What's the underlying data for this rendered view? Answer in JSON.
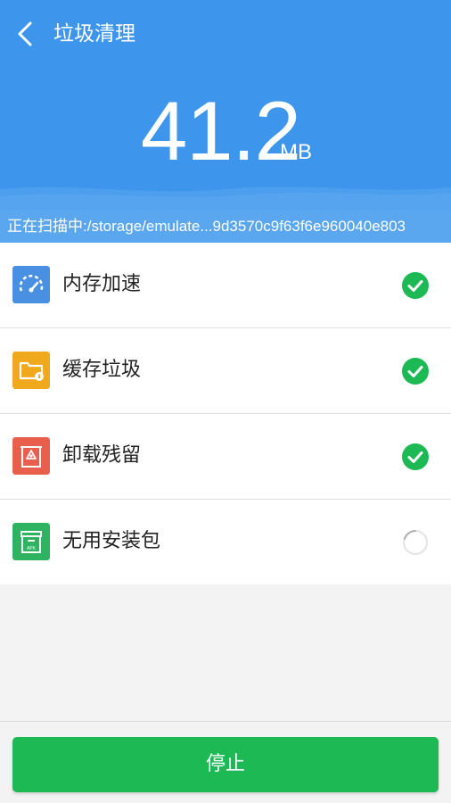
{
  "header": {
    "title": "垃圾清理",
    "back_icon": "chevron-left-icon",
    "size_value": "41.2",
    "size_unit": "MB",
    "scan_text": "正在扫描中:/storage/emulate...9d3570c9f63f6e960040e803"
  },
  "items": [
    {
      "label": "内存加速",
      "icon": "speedometer-icon",
      "icon_color": "#4a90e2",
      "status": "done"
    },
    {
      "label": "缓存垃圾",
      "icon": "folder-cache-icon",
      "icon_color": "#f0a81c",
      "status": "done"
    },
    {
      "label": "卸载残留",
      "icon": "recycle-icon",
      "icon_color": "#e8604c",
      "status": "done"
    },
    {
      "label": "无用安装包",
      "icon": "apk-box-icon",
      "icon_color": "#2fb360",
      "status": "scanning"
    }
  ],
  "apk_tag": "APK",
  "stop_button": "停止",
  "colors": {
    "header": "#3d95ec",
    "check": "#1db954",
    "button": "#1db954"
  }
}
